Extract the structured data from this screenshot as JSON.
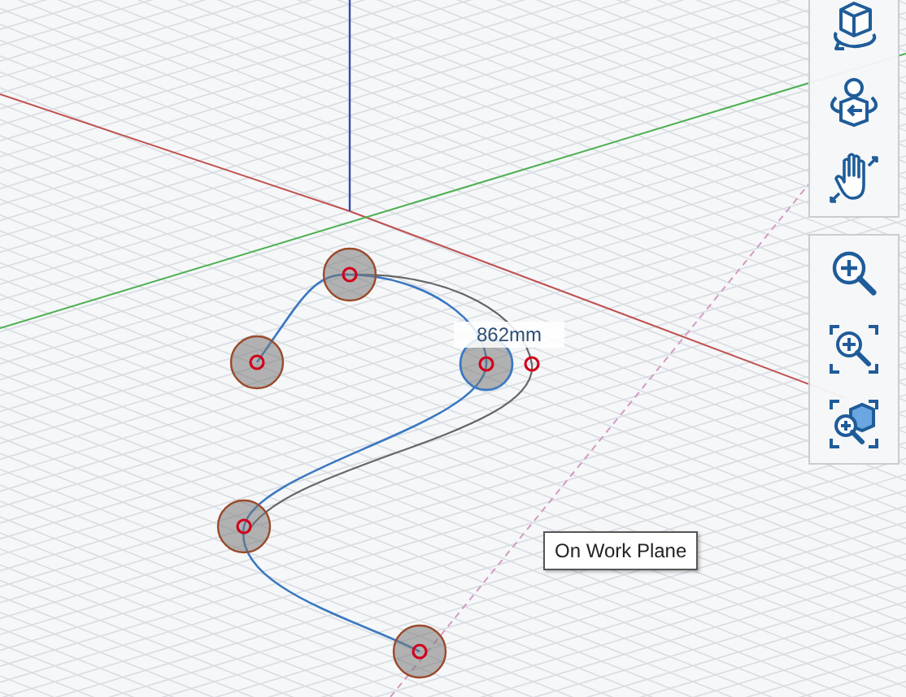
{
  "viewport": {
    "control_points": [
      {
        "selected": false
      },
      {
        "selected": false
      },
      {
        "selected": true
      },
      {
        "selected": false
      },
      {
        "selected": false
      }
    ],
    "dimension": {
      "text": "862mm"
    },
    "snap_tooltip": {
      "text": "On Work Plane"
    }
  },
  "toolbar": {
    "groups": [
      {
        "tools": [
          {
            "kind": "orbit"
          },
          {
            "kind": "look"
          },
          {
            "kind": "pan"
          }
        ]
      },
      {
        "tools": [
          {
            "kind": "zoom"
          },
          {
            "kind": "zoom-window"
          },
          {
            "kind": "zoom-fit"
          }
        ]
      }
    ]
  }
}
